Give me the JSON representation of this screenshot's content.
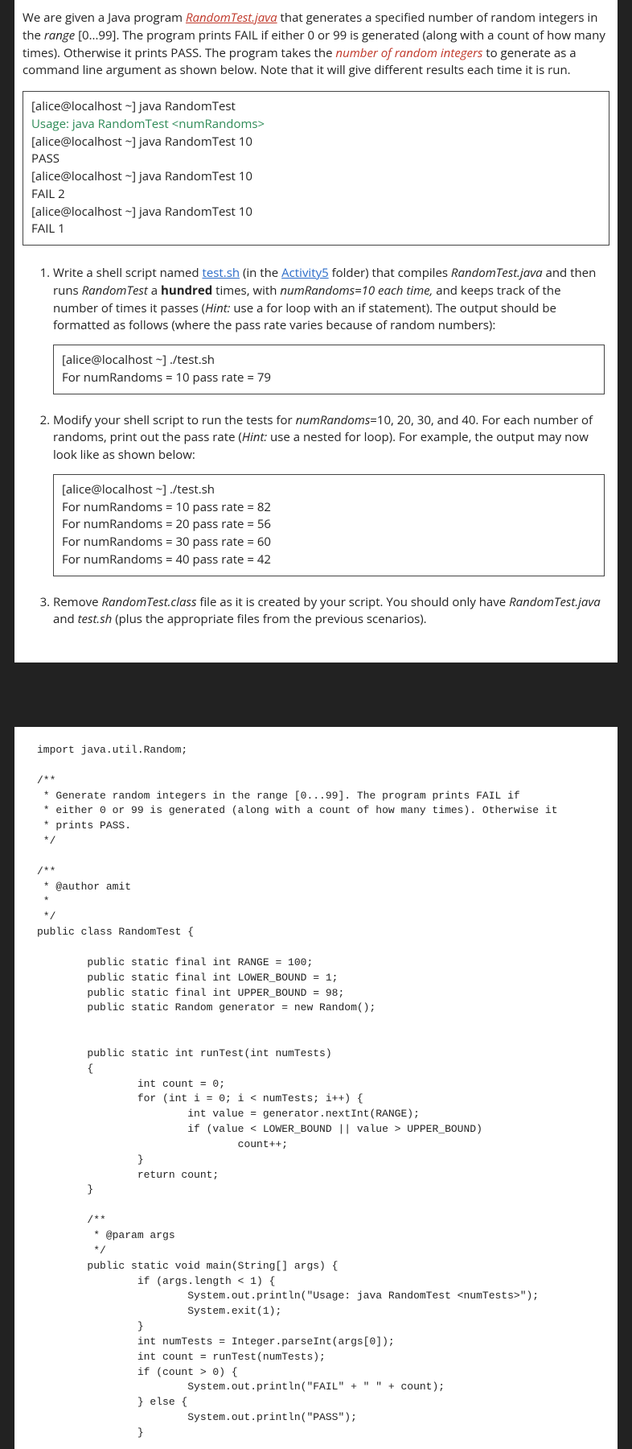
{
  "intro": {
    "pre": "We are given a Java program ",
    "link": "RandomTest.java",
    "mid1": " that generates a specified number of random integers in the ",
    "range": "range",
    "mid2": " [0...99]. The program prints FAIL if either 0 or 99 is generated (along with a count of how many times). Otherwise it prints PASS. The program takes the ",
    "redarg": "number of random integers",
    "post": " to generate as a command line argument as shown below. Note that it will give different results each time it is run."
  },
  "term": {
    "l1": "[alice@localhost ~] java RandomTest",
    "l2": "Usage: java RandomTest <numRandoms>",
    "l3": "[alice@localhost ~] java RandomTest 10",
    "l4": "PASS",
    "l5": "[alice@localhost ~] java RandomTest 10",
    "l6": "FAIL 2",
    "l7": "[alice@localhost ~] java RandomTest 10",
    "l8": "FAIL 1"
  },
  "q1": {
    "a": "Write a shell script named ",
    "testsh": "test.sh",
    "b": " (in the ",
    "folder": "Activity5",
    "c": " folder) that compiles ",
    "rtj": "RandomTest.java",
    "d": " and then runs ",
    "rt": "RandomTest",
    "e": " a ",
    "hundred": "hundred",
    "f": " times, with ",
    "nr10": "numRandoms=10 each time,",
    "g": " and keeps track of the number of times it passes (",
    "hint": "Hint:",
    "h": " use a for loop with an if statement). The output should be formatted as follows (where the pass rate varies because of random numbers):",
    "box": {
      "l1": "[alice@localhost ~] ./test.sh",
      "l2": "For numRandoms = 10     pass rate = 79"
    }
  },
  "q2": {
    "a": "Modify your shell script to run the tests for ",
    "nr": "numRandoms",
    "b": "=10, 20, 30, and 40. For each number of randoms, print out the pass rate (",
    "hint": "Hint:",
    "c": " use a nested for loop). For example, the output may now look like as shown below:",
    "box": {
      "l1": "[alice@localhost ~] ./test.sh",
      "l2": "For numRandoms = 10    pass rate = 82",
      "l3": "For numRandoms = 20    pass rate = 56",
      "l4": "For numRandoms = 30    pass rate = 60",
      "l5": "For numRandoms = 40    pass rate = 42"
    }
  },
  "q3": {
    "a": "Remove ",
    "cls": "RandomTest.class",
    "b": " file as it is created by your script. You should only have ",
    "rtj": "RandomTest.java",
    "c": " and ",
    "testsh": "test.sh",
    "d": "  (plus the appropriate files from the previous scenarios)."
  },
  "code": "import java.util.Random;\n\n/**\n * Generate random integers in the range [0...99]. The program prints FAIL if\n * either 0 or 99 is generated (along with a count of how many times). Otherwise it\n * prints PASS.\n */\n\n/**\n * @author amit\n *\n */\npublic class RandomTest {\n\n        public static final int RANGE = 100;\n        public static final int LOWER_BOUND = 1;\n        public static final int UPPER_BOUND = 98;\n        public static Random generator = new Random();\n\n\n        public static int runTest(int numTests)\n        {\n                int count = 0;\n                for (int i = 0; i < numTests; i++) {\n                        int value = generator.nextInt(RANGE);\n                        if (value < LOWER_BOUND || value > UPPER_BOUND)\n                                count++;\n                }\n                return count;\n        }\n\n        /**\n         * @param args\n         */\n        public static void main(String[] args) {\n                if (args.length < 1) {\n                        System.out.println(\"Usage: java RandomTest <numTests>\");\n                        System.exit(1);\n                }\n                int numTests = Integer.parseInt(args[0]);\n                int count = runTest(numTests);\n                if (count > 0) {\n                        System.out.println(\"FAIL\" + \" \" + count);\n                } else {\n                        System.out.println(\"PASS\");\n                }"
}
